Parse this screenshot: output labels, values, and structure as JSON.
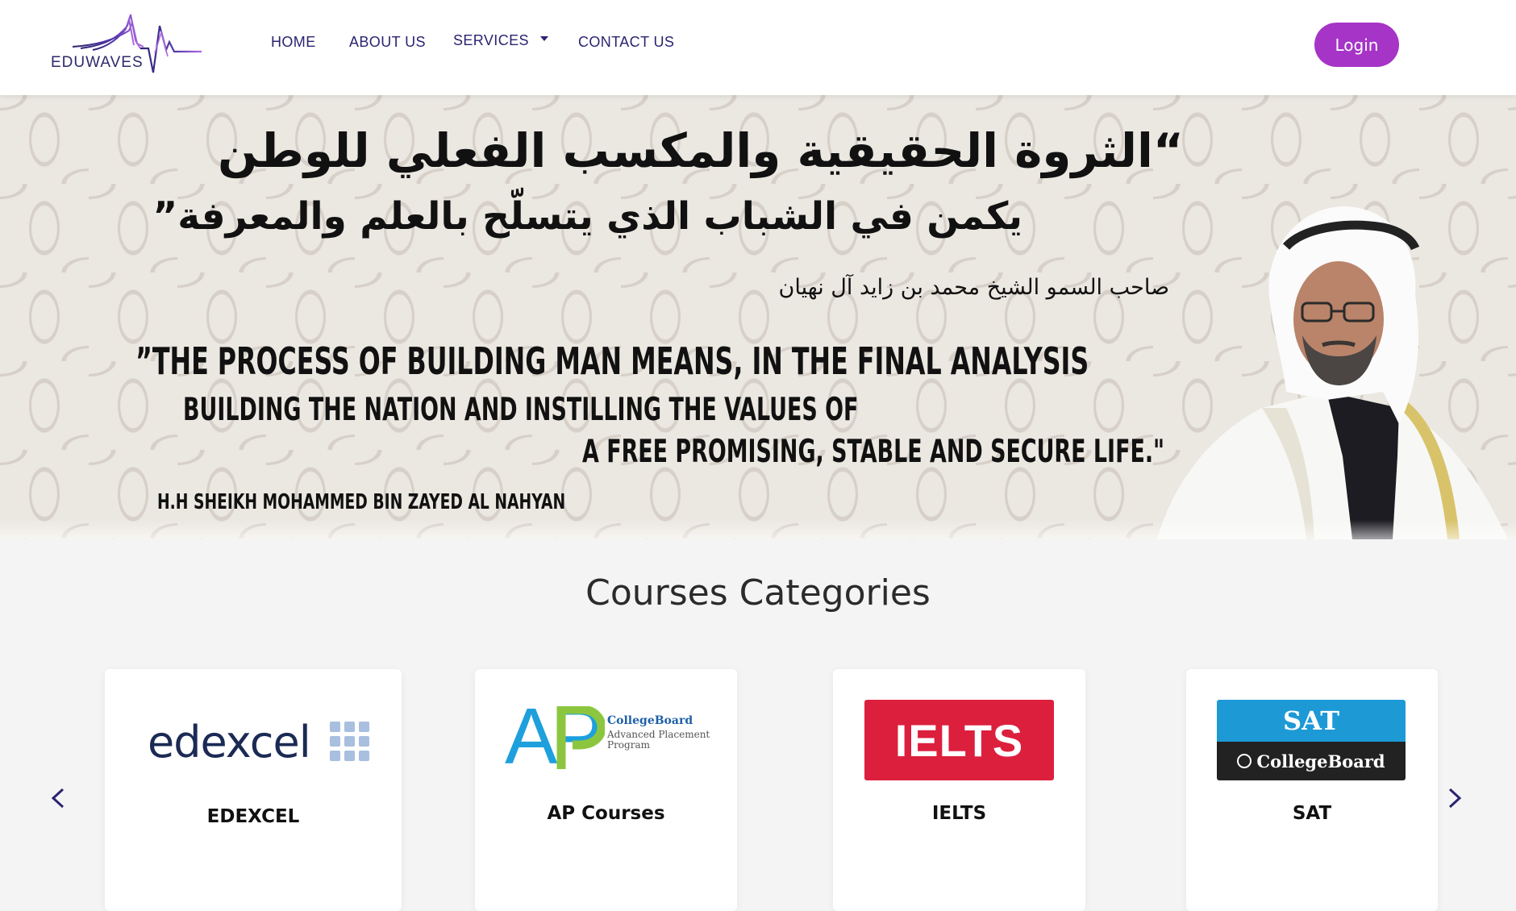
{
  "brand": {
    "logo_text": "EDUWAVES",
    "primary_color": "#2a2470",
    "accent_color": "#a634c7"
  },
  "nav": {
    "home": "HOME",
    "about": "ABOUT US",
    "services": "SERVICES",
    "contact": "CONTACT US",
    "login": "Login"
  },
  "hero": {
    "arabic_line1": "“الثروة الحقيقية والمكسب الفعلي للوطن",
    "arabic_line2": "يكمن في الشباب الذي يتسلّح بالعلم والمعرفة”",
    "arabic_attribution": "صاحب السمو الشيخ محمد بن زايد آل نهيان",
    "english_line1": "”THE PROCESS OF BUILDING MAN MEANS, IN THE FINAL ANALYSIS",
    "english_line2": "BUILDING THE NATION AND INSTILLING THE VALUES OF",
    "english_line3": "A FREE PROMISING, STABLE AND SECURE LIFE.\"",
    "english_attribution": "H.H SHEIKH MOHAMMED BIN ZAYED AL NAHYAN"
  },
  "courses": {
    "title": "Courses Categories",
    "items": [
      {
        "label": "EDEXCEL",
        "logo_text": "edexcel"
      },
      {
        "label": "AP Courses",
        "logo_text": "AP",
        "logo_sub1": "CollegeBoard",
        "logo_sub2": "Advanced Placement",
        "logo_sub3": "Program"
      },
      {
        "label": "IELTS",
        "logo_text": "IELTS"
      },
      {
        "label": "SAT",
        "logo_text": "SAT",
        "logo_sub1": "CollegeBoard"
      }
    ]
  },
  "icons": {
    "services_dropdown": "caret-down-icon",
    "carousel_prev": "chevron-left-icon",
    "carousel_next": "chevron-right-icon"
  }
}
